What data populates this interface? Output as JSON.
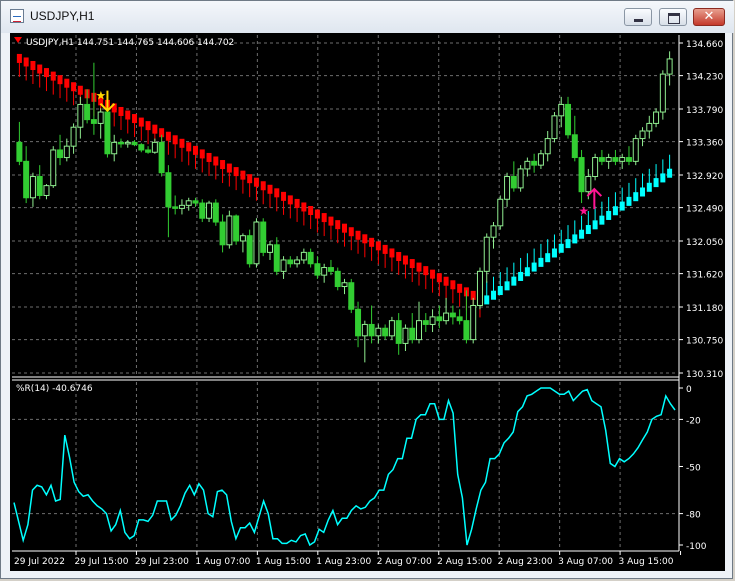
{
  "window": {
    "title": "USDJPY,H1",
    "minimize_icon": "minimize-icon",
    "maximize_icon": "maximize-icon",
    "close_icon": "close-icon",
    "close_glyph": "✕"
  },
  "chart_data": [
    {
      "type": "candlestick",
      "title": "USDJPY,H1",
      "ohlc_label": "144.751 144.765 144.606 144.702",
      "ylim": [
        130.31,
        134.66
      ],
      "y_ticks": [
        "134.660",
        "134.230",
        "133.790",
        "133.360",
        "132.920",
        "132.490",
        "132.050",
        "131.620",
        "131.180",
        "130.750",
        "130.310"
      ],
      "grid": true,
      "colors": {
        "background": "#000000",
        "bull": "#90ee90",
        "bear": "#32cd32",
        "grid": "#6e6e6e",
        "text": "#ffffff",
        "down_trend": "#ff0000",
        "up_trend": "#00ffff",
        "sell_signal": "#ffd700",
        "buy_signal": "#ff1493"
      },
      "candles": [
        {
          "o": 133.35,
          "h": 133.62,
          "l": 133.05,
          "c": 133.1
        },
        {
          "o": 133.1,
          "h": 133.3,
          "l": 132.55,
          "c": 132.62
        },
        {
          "o": 132.62,
          "h": 132.95,
          "l": 132.5,
          "c": 132.9
        },
        {
          "o": 132.9,
          "h": 133.05,
          "l": 132.6,
          "c": 132.65
        },
        {
          "o": 132.65,
          "h": 132.8,
          "l": 132.6,
          "c": 132.78
        },
        {
          "o": 132.78,
          "h": 133.3,
          "l": 132.75,
          "c": 133.25
        },
        {
          "o": 133.25,
          "h": 133.45,
          "l": 133.05,
          "c": 133.15
        },
        {
          "o": 133.15,
          "h": 133.4,
          "l": 133.1,
          "c": 133.3
        },
        {
          "o": 133.3,
          "h": 133.6,
          "l": 133.2,
          "c": 133.55
        },
        {
          "o": 133.55,
          "h": 133.95,
          "l": 133.4,
          "c": 133.85
        },
        {
          "o": 133.85,
          "h": 134.05,
          "l": 133.6,
          "c": 133.65
        },
        {
          "o": 133.65,
          "h": 134.4,
          "l": 133.45,
          "c": 133.6
        },
        {
          "o": 133.6,
          "h": 133.8,
          "l": 133.4,
          "c": 133.75
        },
        {
          "o": 133.75,
          "h": 133.9,
          "l": 133.15,
          "c": 133.2
        },
        {
          "o": 133.2,
          "h": 133.45,
          "l": 133.1,
          "c": 133.35
        },
        {
          "o": 133.35,
          "h": 133.4,
          "l": 133.28,
          "c": 133.33
        },
        {
          "o": 133.33,
          "h": 133.38,
          "l": 133.28,
          "c": 133.35
        },
        {
          "o": 133.35,
          "h": 133.38,
          "l": 133.3,
          "c": 133.32
        },
        {
          "o": 133.32,
          "h": 133.34,
          "l": 133.22,
          "c": 133.25
        },
        {
          "o": 133.25,
          "h": 133.3,
          "l": 133.2,
          "c": 133.22
        },
        {
          "o": 133.22,
          "h": 133.4,
          "l": 133.2,
          "c": 133.35
        },
        {
          "o": 133.35,
          "h": 133.45,
          "l": 132.9,
          "c": 132.95
        },
        {
          "o": 132.95,
          "h": 133.05,
          "l": 132.1,
          "c": 132.5
        },
        {
          "o": 132.5,
          "h": 132.65,
          "l": 132.4,
          "c": 132.48
        },
        {
          "o": 132.48,
          "h": 132.6,
          "l": 132.4,
          "c": 132.52
        },
        {
          "o": 132.52,
          "h": 132.62,
          "l": 132.45,
          "c": 132.58
        },
        {
          "o": 132.58,
          "h": 132.62,
          "l": 132.5,
          "c": 132.55
        },
        {
          "o": 132.55,
          "h": 132.6,
          "l": 132.3,
          "c": 132.35
        },
        {
          "o": 132.35,
          "h": 132.58,
          "l": 132.3,
          "c": 132.55
        },
        {
          "o": 132.55,
          "h": 132.6,
          "l": 132.25,
          "c": 132.3
        },
        {
          "o": 132.3,
          "h": 132.4,
          "l": 131.9,
          "c": 132.0
        },
        {
          "o": 132.0,
          "h": 132.45,
          "l": 131.95,
          "c": 132.38
        },
        {
          "o": 132.38,
          "h": 132.4,
          "l": 132.0,
          "c": 132.05
        },
        {
          "o": 132.05,
          "h": 132.15,
          "l": 131.9,
          "c": 132.12
        },
        {
          "o": 132.12,
          "h": 132.2,
          "l": 131.7,
          "c": 131.75
        },
        {
          "o": 131.75,
          "h": 132.35,
          "l": 131.7,
          "c": 132.3
        },
        {
          "o": 132.3,
          "h": 132.35,
          "l": 131.85,
          "c": 131.9
        },
        {
          "o": 131.9,
          "h": 132.05,
          "l": 131.8,
          "c": 132.0
        },
        {
          "o": 132.0,
          "h": 132.1,
          "l": 131.6,
          "c": 131.65
        },
        {
          "o": 131.65,
          "h": 131.85,
          "l": 131.55,
          "c": 131.8
        },
        {
          "o": 131.8,
          "h": 131.85,
          "l": 131.7,
          "c": 131.75
        },
        {
          "o": 131.75,
          "h": 131.85,
          "l": 131.7,
          "c": 131.8
        },
        {
          "o": 131.8,
          "h": 131.95,
          "l": 131.75,
          "c": 131.9
        },
        {
          "o": 131.9,
          "h": 131.95,
          "l": 131.7,
          "c": 131.75
        },
        {
          "o": 131.75,
          "h": 131.85,
          "l": 131.55,
          "c": 131.6
        },
        {
          "o": 131.6,
          "h": 131.75,
          "l": 131.5,
          "c": 131.7
        },
        {
          "o": 131.7,
          "h": 131.8,
          "l": 131.6,
          "c": 131.65
        },
        {
          "o": 131.65,
          "h": 131.7,
          "l": 131.4,
          "c": 131.45
        },
        {
          "o": 131.45,
          "h": 131.55,
          "l": 131.35,
          "c": 131.5
        },
        {
          "o": 131.5,
          "h": 131.55,
          "l": 131.1,
          "c": 131.15
        },
        {
          "o": 131.15,
          "h": 131.25,
          "l": 130.65,
          "c": 130.8
        },
        {
          "o": 130.8,
          "h": 131.0,
          "l": 130.45,
          "c": 130.95
        },
        {
          "o": 130.95,
          "h": 131.2,
          "l": 130.7,
          "c": 130.8
        },
        {
          "o": 130.8,
          "h": 130.95,
          "l": 130.7,
          "c": 130.9
        },
        {
          "o": 130.9,
          "h": 130.95,
          "l": 130.75,
          "c": 130.8
        },
        {
          "o": 130.8,
          "h": 131.05,
          "l": 130.75,
          "c": 131.0
        },
        {
          "o": 131.0,
          "h": 131.1,
          "l": 130.55,
          "c": 130.7
        },
        {
          "o": 130.7,
          "h": 130.95,
          "l": 130.6,
          "c": 130.9
        },
        {
          "o": 130.9,
          "h": 131.1,
          "l": 130.7,
          "c": 130.75
        },
        {
          "o": 130.75,
          "h": 131.25,
          "l": 130.7,
          "c": 131.0
        },
        {
          "o": 131.0,
          "h": 131.1,
          "l": 130.85,
          "c": 130.95
        },
        {
          "o": 130.95,
          "h": 131.15,
          "l": 130.85,
          "c": 131.05
        },
        {
          "o": 131.05,
          "h": 131.2,
          "l": 130.9,
          "c": 131.0
        },
        {
          "o": 131.0,
          "h": 131.3,
          "l": 130.95,
          "c": 131.1
        },
        {
          "o": 131.1,
          "h": 131.2,
          "l": 130.95,
          "c": 131.05
        },
        {
          "o": 131.05,
          "h": 131.15,
          "l": 130.95,
          "c": 131.0
        },
        {
          "o": 131.0,
          "h": 131.4,
          "l": 130.7,
          "c": 130.75
        },
        {
          "o": 130.75,
          "h": 131.3,
          "l": 130.7,
          "c": 131.2
        },
        {
          "o": 131.2,
          "h": 131.7,
          "l": 131.15,
          "c": 131.65
        },
        {
          "o": 131.65,
          "h": 132.15,
          "l": 131.5,
          "c": 132.1
        },
        {
          "o": 132.1,
          "h": 132.3,
          "l": 131.95,
          "c": 132.25
        },
        {
          "o": 132.25,
          "h": 132.65,
          "l": 132.2,
          "c": 132.6
        },
        {
          "o": 132.6,
          "h": 132.95,
          "l": 132.5,
          "c": 132.9
        },
        {
          "o": 132.9,
          "h": 133.1,
          "l": 132.7,
          "c": 132.75
        },
        {
          "o": 132.75,
          "h": 133.05,
          "l": 132.7,
          "c": 133.0
        },
        {
          "o": 133.0,
          "h": 133.15,
          "l": 132.9,
          "c": 133.1
        },
        {
          "o": 133.1,
          "h": 133.2,
          "l": 132.95,
          "c": 133.05
        },
        {
          "o": 133.05,
          "h": 133.25,
          "l": 133.0,
          "c": 133.2
        },
        {
          "o": 133.2,
          "h": 133.5,
          "l": 133.1,
          "c": 133.4
        },
        {
          "o": 133.4,
          "h": 133.75,
          "l": 133.35,
          "c": 133.7
        },
        {
          "o": 133.7,
          "h": 133.95,
          "l": 133.55,
          "c": 133.85
        },
        {
          "o": 133.85,
          "h": 133.95,
          "l": 133.4,
          "c": 133.45
        },
        {
          "o": 133.45,
          "h": 133.7,
          "l": 133.1,
          "c": 133.15
        },
        {
          "o": 133.15,
          "h": 133.25,
          "l": 132.55,
          "c": 132.7
        },
        {
          "o": 132.7,
          "h": 133.0,
          "l": 132.6,
          "c": 132.9
        },
        {
          "o": 132.9,
          "h": 133.2,
          "l": 132.85,
          "c": 133.15
        },
        {
          "o": 133.15,
          "h": 133.25,
          "l": 133.05,
          "c": 133.1
        },
        {
          "o": 133.1,
          "h": 133.2,
          "l": 133.0,
          "c": 133.15
        },
        {
          "o": 133.15,
          "h": 133.25,
          "l": 133.05,
          "c": 133.1
        },
        {
          "o": 133.1,
          "h": 133.2,
          "l": 133.0,
          "c": 133.15
        },
        {
          "o": 133.15,
          "h": 133.3,
          "l": 133.05,
          "c": 133.1
        },
        {
          "o": 133.1,
          "h": 133.45,
          "l": 133.05,
          "c": 133.4
        },
        {
          "o": 133.4,
          "h": 133.55,
          "l": 133.3,
          "c": 133.5
        },
        {
          "o": 133.5,
          "h": 133.7,
          "l": 133.4,
          "c": 133.6
        },
        {
          "o": 133.6,
          "h": 133.8,
          "l": 133.55,
          "c": 133.75
        },
        {
          "o": 133.75,
          "h": 134.3,
          "l": 133.65,
          "c": 134.25
        },
        {
          "o": 134.25,
          "h": 134.55,
          "l": 134.1,
          "c": 134.45
        }
      ],
      "trend_down": {
        "start_price": 134.45,
        "end_price": 131.28,
        "start_index": 0,
        "end_index": 68
      },
      "trend_up": {
        "start_price": 131.28,
        "end_price": 132.95,
        "start_index": 69,
        "end_index": 96
      },
      "signals": [
        {
          "kind": "sell",
          "index": 13,
          "price": 133.9
        },
        {
          "kind": "buy",
          "index": 84,
          "price": 132.55
        }
      ]
    },
    {
      "type": "line",
      "title": "%R(14) -40.6746",
      "series": [
        {
          "name": "%R(14)"
        }
      ],
      "ylim": [
        -100,
        0
      ],
      "y_ticks": [
        "0",
        "-20",
        "-50",
        "-80",
        "-100"
      ],
      "grid": true,
      "color": "#00ffff",
      "values": [
        -73,
        -85,
        -97,
        -87,
        -65,
        -62,
        -63,
        -68,
        -62,
        -72,
        -71,
        -30,
        -44,
        -60,
        -66,
        -69,
        -68,
        -72,
        -75,
        -77,
        -80,
        -91,
        -87,
        -78,
        -92,
        -96,
        -94,
        -84,
        -84,
        -85,
        -81,
        -72,
        -72,
        -72,
        -84,
        -81,
        -75,
        -67,
        -62,
        -68,
        -61,
        -65,
        -80,
        -82,
        -66,
        -65,
        -68,
        -85,
        -96,
        -89,
        -89,
        -86,
        -92,
        -82,
        -72,
        -80,
        -96,
        -96,
        -99,
        -99,
        -97,
        -98,
        -94,
        -93,
        -100,
        -98,
        -90,
        -92,
        -84,
        -78,
        -87,
        -83,
        -83,
        -78,
        -75,
        -77,
        -76,
        -72,
        -70,
        -65,
        -65,
        -55,
        -52,
        -45,
        -45,
        -32,
        -32,
        -20,
        -17,
        -17,
        -10,
        -10,
        -20,
        -20,
        -8,
        -16,
        -55,
        -70,
        -100,
        -90,
        -77,
        -65,
        -60,
        -45,
        -45,
        -42,
        -35,
        -32,
        -28,
        -15,
        -12,
        -5,
        -4,
        -2,
        0,
        0,
        0,
        -2,
        -4,
        -4,
        -2,
        -8,
        -5,
        -2,
        -1,
        -8,
        -10,
        -12,
        -27,
        -48,
        -50,
        -45,
        -47,
        -45,
        -42,
        -38,
        -33,
        -28,
        -20,
        -18,
        -17,
        -5,
        -10,
        -14
      ]
    }
  ],
  "x_ticks": [
    "29 Jul 2022",
    "29 Jul 15:00",
    "29 Jul 23:00",
    "1 Aug 07:00",
    "1 Aug 15:00",
    "1 Aug 23:00",
    "2 Aug 07:00",
    "2 Aug 15:00",
    "2 Aug 23:00",
    "3 Aug 07:00",
    "3 Aug 15:00"
  ],
  "indicator_label": "%R(14) -40.6746",
  "main_label": "USDJPY,H1  144.751 144.765 144.606 144.702"
}
